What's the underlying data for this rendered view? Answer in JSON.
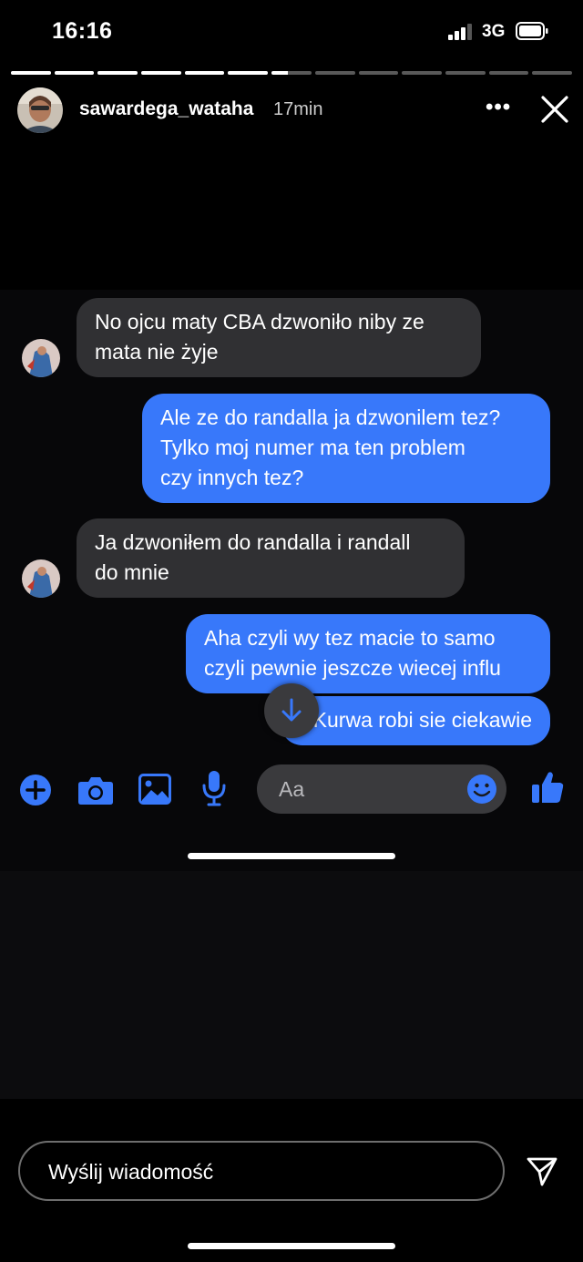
{
  "status_bar": {
    "time": "16:16",
    "network": "3G"
  },
  "story": {
    "progress": {
      "segments": 13,
      "completed": 6,
      "current_fraction": 0.4
    },
    "username": "sawardega_wataha",
    "age": "17min"
  },
  "chat": {
    "messages": [
      {
        "direction": "in",
        "lines": [
          "No ojcu maty CBA dzwoniło niby ze",
          "mata nie żyje"
        ]
      },
      {
        "direction": "out",
        "lines": [
          "Ale ze do randalla ja dzwonilem tez?",
          "Tylko moj numer ma ten problem",
          "czy innych tez?"
        ]
      },
      {
        "direction": "in",
        "lines": [
          "Ja dzwoniłem do randalla i randall",
          "do mnie"
        ]
      },
      {
        "direction": "out",
        "lines": [
          "Aha czyli wy tez macie to samo",
          "czyli pewnie jeszcze wiecej influ"
        ]
      },
      {
        "direction": "out",
        "lines": [
          "Kurwa robi sie ciekawie"
        ]
      }
    ],
    "input_placeholder": "Aa",
    "icons": [
      "plus-icon",
      "camera-icon",
      "image-icon",
      "microphone-icon",
      "emoji-icon",
      "thumbs-up-icon",
      "arrow-down-icon"
    ],
    "accent_color": "#3878fa"
  },
  "reply": {
    "placeholder": "Wyślij wiadomość",
    "send_icon": "send-icon"
  }
}
